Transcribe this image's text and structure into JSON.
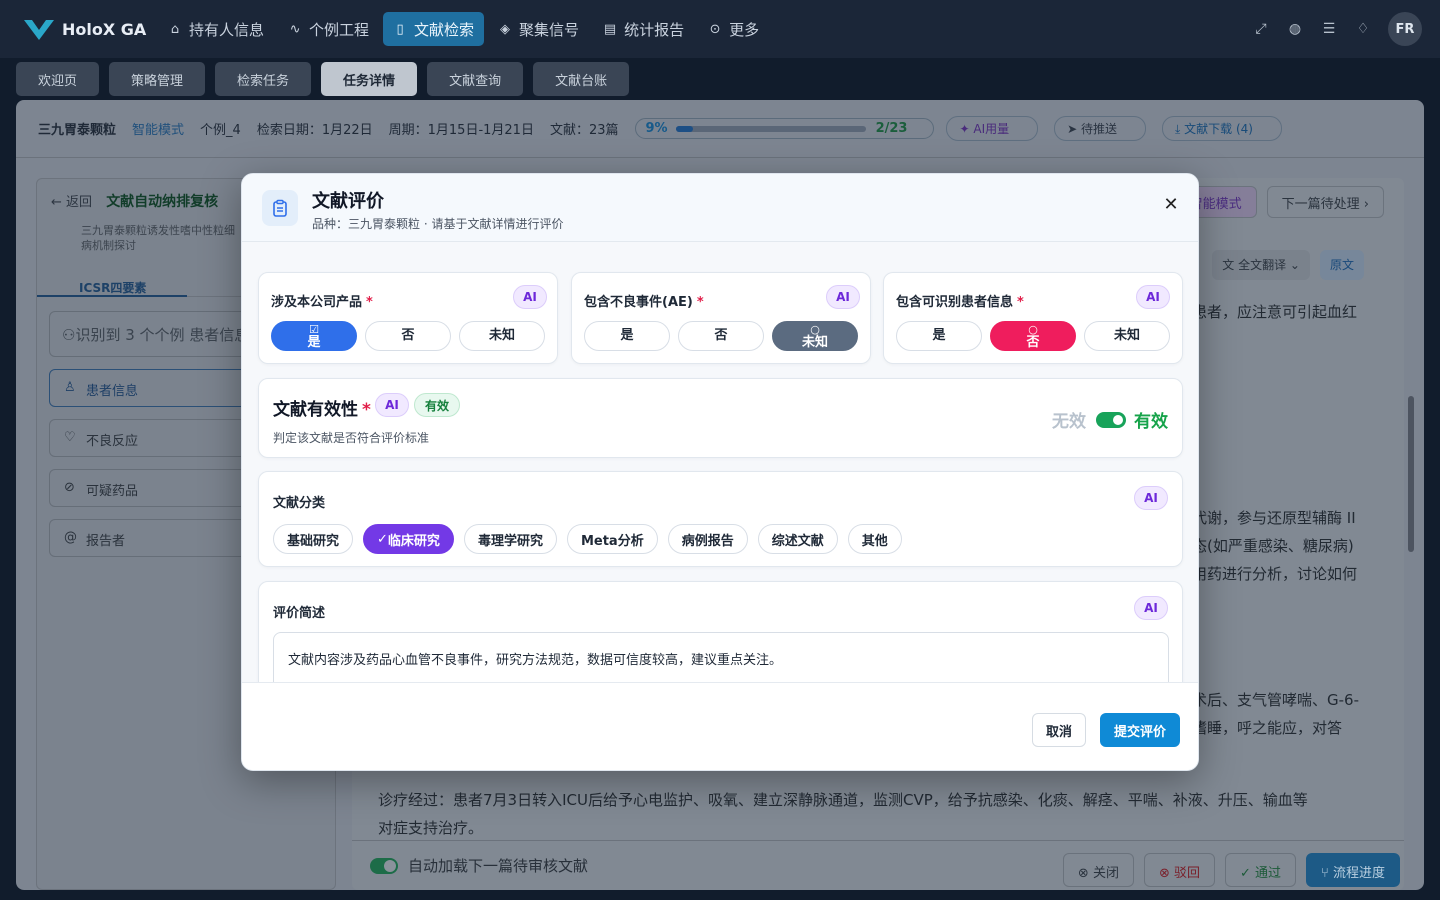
{
  "nav": {
    "brand": "HoloX GA",
    "items": [
      {
        "label": "持有人信息",
        "icon": "bank-icon"
      },
      {
        "label": "个例工程",
        "icon": "pulse-icon"
      },
      {
        "label": "文献检索",
        "icon": "book-icon"
      },
      {
        "label": "聚集信号",
        "icon": "layers-icon"
      },
      {
        "label": "统计报告",
        "icon": "document-icon"
      },
      {
        "label": "更多",
        "icon": "more-icon"
      }
    ],
    "active_index": 2,
    "avatar": "FR",
    "colors": {
      "active": "#1f6fa0",
      "bar": "#1b2638"
    }
  },
  "tabs": [
    "欢迎页",
    "策略管理",
    "检索任务",
    "任务详情",
    "文献查询",
    "文献台账"
  ],
  "active_tab": "任务详情",
  "infobar": {
    "product": "三九胃泰颗粒",
    "mode": "智能模式",
    "case": "个例_4",
    "search_date": "检索日期：1月22日",
    "period": "周期：1月15日-1月21日",
    "docs": "文献：23篇",
    "progress_pct": "9%",
    "progress_value": 0.09,
    "progress_count": "2/23",
    "ai_usage": "AI用量",
    "pending_push": "待推送",
    "download": "文献下载 (4)"
  },
  "left": {
    "back": "返回",
    "title": "文献自动纳排复核",
    "subtitle_1": "三九胃泰颗粒诱发性嗜中性粒细",
    "subtitle_2": "病机制探讨",
    "icsr_tab": "ICSR四要素",
    "search_text": "识别到 3 个个例   患者信息",
    "items": [
      "患者信息",
      "不良反应",
      "可疑药品",
      "报告者"
    ]
  },
  "right": {
    "mode_btn": "智能模式",
    "next_btn": "下一篇待处理",
    "translate": "全文翻译",
    "original": "原文",
    "text_1": "患者，应注意可引起血红",
    "text_2": "代谢，参与还原型辅酶 II",
    "text_3": "态(如严重感染、糖尿病)",
    "text_4": "用药进行分析，讨论如何",
    "text_5": "术后、支气管哮喘、G-6-",
    "text_6": "嗜睡，呼之能应，对答",
    "text_7": "诊疗经过：患者7月3日转入ICU后给予心电监护、吸氧、建立深静脉通道，监测CVP，给予抗感染、化痰、解痉、平喘、补液、升压、输血等",
    "text_8": "对症支持治疗。",
    "auto_load": "自动加载下一篇待审核文献",
    "btn_close": "关闭",
    "btn_reject": "驳回",
    "btn_pass": "通过",
    "btn_flow": "流程进度"
  },
  "modal": {
    "title": "文献评价",
    "subtitle": "品种：三九胃泰颗粒 · 请基于文献详情进行评价",
    "ai_tag": "AI",
    "questions": [
      {
        "label": "涉及本公司产品",
        "options": [
          "是",
          "否",
          "未知"
        ],
        "selected": "是"
      },
      {
        "label": "包含不良事件(AE)",
        "options": [
          "是",
          "否",
          "未知"
        ],
        "selected": "未知"
      },
      {
        "label": "包含可识别患者信息",
        "options": [
          "是",
          "否",
          "未知"
        ],
        "selected": "否"
      }
    ],
    "validity": {
      "title": "文献有效性",
      "status_tag": "有效",
      "desc": "判定该文献是否符合评价标准",
      "off_label": "无效",
      "on_label": "有效",
      "value": true
    },
    "category": {
      "label": "文献分类",
      "options": [
        "基础研究",
        "临床研究",
        "毒理学研究",
        "Meta分析",
        "病例报告",
        "综述文献",
        "其他"
      ],
      "selected": "临床研究"
    },
    "summary": {
      "label": "评价简述",
      "value": "文献内容涉及药品心血管不良事件，研究方法规范，数据可信度较高，建议重点关注。"
    },
    "cancel": "取消",
    "submit": "提交评价",
    "colors": {
      "blue": "#2f6fea",
      "gray": "#5b6b80",
      "red": "#ef1d5d",
      "purple": "#7339e6",
      "green": "#16a34a",
      "submit": "#0f8ad6"
    }
  }
}
